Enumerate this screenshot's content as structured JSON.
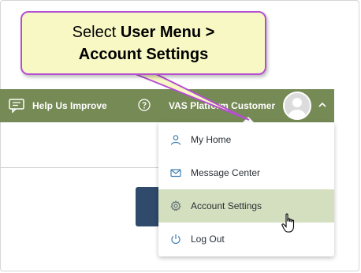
{
  "callout": {
    "prefix": "Select ",
    "bold_line1": "User Menu >",
    "bold_line2": "Account Settings"
  },
  "topbar": {
    "help_improve_label": "Help Us Improve",
    "user_name": "VAS Platform Customer"
  },
  "user_menu": {
    "items": [
      {
        "label": "My Home",
        "icon": "person-icon"
      },
      {
        "label": "Message Center",
        "icon": "envelope-icon"
      },
      {
        "label": "Account Settings",
        "icon": "gear-icon",
        "active": true
      },
      {
        "label": "Log Out",
        "icon": "power-icon"
      }
    ]
  },
  "colors": {
    "topbar": "#768a55",
    "active_item": "#d3dfbe",
    "callout_fill": "#f8f8c4",
    "callout_border": "#b44fd1"
  }
}
